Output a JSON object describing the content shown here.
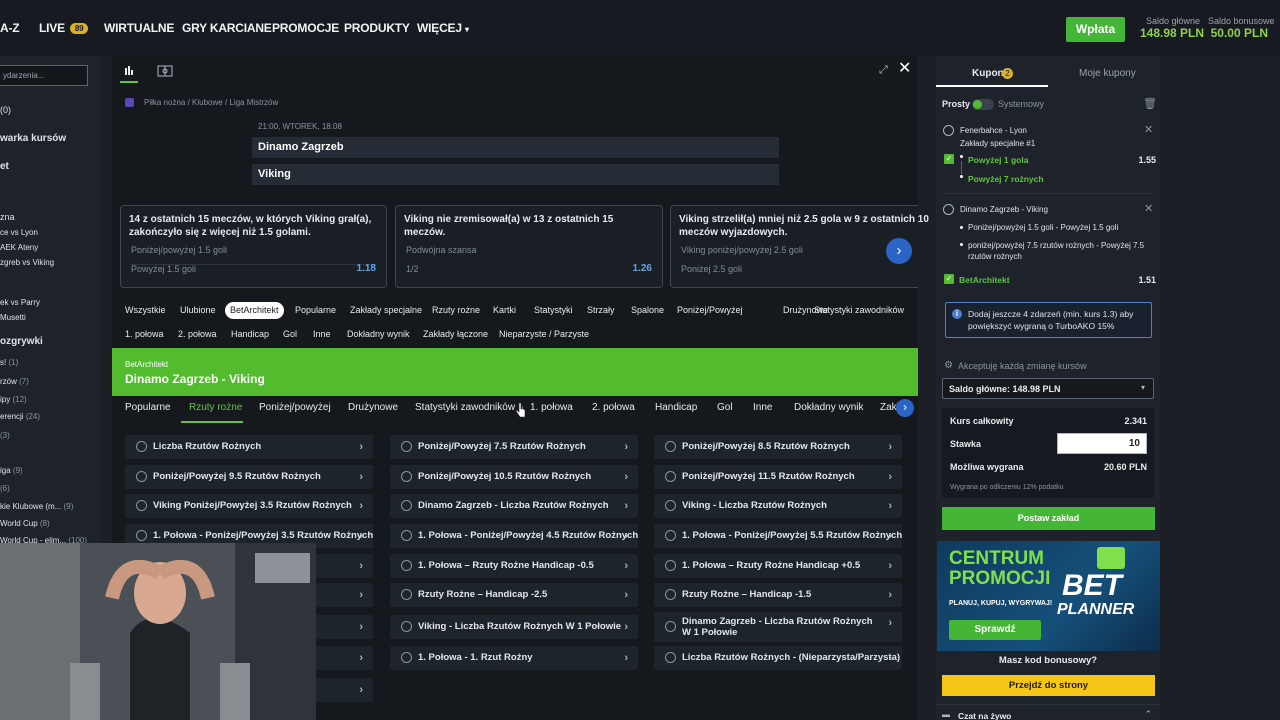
{
  "topnav": {
    "az": "A-Z",
    "live": "LIVE",
    "live_badge": "89",
    "items": [
      "WIRTUALNE",
      "GRY KARCIANE",
      "PROMOCJE",
      "PRODUKTY"
    ],
    "more": "WIĘCEJ"
  },
  "deposit_label": "Wpłata",
  "balance": {
    "main_label": "Saldo główne",
    "main_value": "148.98 PLN",
    "bonus_label": "Saldo bonusowe",
    "bonus_value": "50.00 PLN"
  },
  "sidebar": {
    "search_placeholder": "ydarzenia...",
    "items": [
      {
        "label": "(0)"
      },
      {
        "label": "warka kursów"
      },
      {
        "label": "et"
      },
      {
        "label": "zna"
      },
      {
        "label": "ce vs Lyon"
      },
      {
        "label": "AEK Ateny"
      },
      {
        "label": "zgreb vs Viking"
      },
      {
        "label": "ek vs Parry"
      },
      {
        "label": "Musetti"
      },
      {
        "label": "ozgrywki"
      },
      {
        "label": "s!",
        "count": "(1)"
      },
      {
        "label": "rzów",
        "count": "(7)"
      },
      {
        "label": "ipy",
        "count": "(12)"
      },
      {
        "label": "erencji",
        "count": "(24)"
      },
      {
        "label": "",
        "count": "(3)"
      },
      {
        "label": "iga",
        "count": "(9)"
      },
      {
        "label": "",
        "count": "(6)"
      },
      {
        "label": "kie Klubowe (m...",
        "count": "(9)"
      },
      {
        "label": "World Cup",
        "count": "(8)"
      },
      {
        "label": "World Cup - elim...",
        "count": "(100)"
      }
    ]
  },
  "event": {
    "breadcrumb": "Piłka nożna / Klubowe / Liga Mistrzów",
    "datetime": "21:00, WTOREK, 18.08",
    "home": "Dinamo Zagrzeb",
    "away": "Viking"
  },
  "stats_cards": [
    {
      "text": "14 z ostatnich 15 meczów, w których Viking grał(a), zakończyło się z więcej niż 1.5 golami.",
      "market": "Poniżej/powyżej 1.5 goli",
      "selection": "Powyżej 1.5 goli",
      "odd": "1.18"
    },
    {
      "text": "Viking nie zremisował(a) w 13 z ostatnich 15 meczów.",
      "market": "Podwójna szansa",
      "selection": "1/2",
      "odd": "1.26"
    },
    {
      "text": "Viking strzelił(a) mniej niż 2.5 gola w 9 z ostatnich 10 meczów wyjazdowych.",
      "market": "Viking poniżej/powyżej 2.5 goli",
      "selection": "Poniżej 2.5 goli",
      "odd": ""
    }
  ],
  "filter_row1": [
    "Wszystkie",
    "Ulubione",
    "BetArchitekt",
    "Popularne",
    "Zakłady specjalne",
    "Rzuty rożne",
    "Kartki",
    "Statystyki",
    "Strzały",
    "Spalone",
    "Poniżej/Powyżej",
    "Drużynowe",
    "Statystyki zawodników"
  ],
  "filter_row2": [
    "1. połowa",
    "2. połowa",
    "Handicap",
    "Gol",
    "Inne",
    "Dokładny wynik",
    "Zakłady łączone",
    "Nieparzyste / Parzyste"
  ],
  "betarchitekt": {
    "label": "BetArchitekt",
    "match": "Dinamo Zagrzeb - Viking"
  },
  "market_tabs": [
    "Popularne",
    "Rzuty rożne",
    "Poniżej/powyżej",
    "Drużynowe",
    "Statystyki zawodników",
    "1. połowa",
    "2. połowa",
    "Handicap",
    "Gol",
    "Inne",
    "Dokładny wynik",
    "Zakł"
  ],
  "markets": [
    [
      "Liczba Rzutów Rożnych",
      "Poniżej/Powyżej 7.5 Rzutów Rożnych",
      "Poniżej/Powyżej 8.5 Rzutów Rożnych"
    ],
    [
      "Poniżej/Powyżej 9.5 Rzutów Rożnych",
      "Poniżej/Powyżej 10.5 Rzutów Rożnych",
      "Poniżej/Powyżej 11.5 Rzutów Rożnych"
    ],
    [
      "Viking Poniżej/Powyżej 3.5 Rzutów Rożnych",
      "Dinamo Zagrzeb - Liczba Rzutów Rożnych",
      "Viking - Liczba Rzutów Rożnych"
    ],
    [
      "1. Połowa - Poniżej/Powyżej 3.5 Rzutów Rożnych",
      "1. Połowa - Poniżej/Powyżej 4.5 Rzutów Rożnych",
      "1. Połowa - Poniżej/Powyżej 5.5 Rzutów Rożnych"
    ],
    [
      "",
      "1. Połowa – Rzuty Rożne Handicap -0.5",
      "1. Połowa – Rzuty Rożne Handicap +0.5"
    ],
    [
      "",
      "Rzuty Rożne – Handicap -2.5",
      "Rzuty Rożne – Handicap -1.5"
    ],
    [
      "",
      "Viking - Liczba Rzutów Rożnych W 1 Połowie",
      "Dinamo Zagrzeb - Liczba Rzutów Rożnych W 1 Połowie"
    ],
    [
      "",
      "1. Połowa - 1. Rzut Rożny",
      "Liczba Rzutów Rożnych - (Nieparzysta/Parzysta)"
    ]
  ],
  "coupon": {
    "tab_coupon": "Kupon",
    "coupon_count": "2",
    "tab_my": "Moje kupony",
    "mode_simple": "Prosty",
    "mode_system": "Systemowy",
    "bet1": {
      "event": "Fenerbahce - Lyon",
      "market": "Zakłady specjalne #1",
      "sel1": "Powyżej 1 gola",
      "sel2": "Powyżej 7 rożnych",
      "odd": "1.55"
    },
    "bet2": {
      "event": "Dinamo Zagrzeb - Viking",
      "sel1": "Poniżej/powyżej 1.5 goli - Powyżej 1.5 goli",
      "sel2": "poniżej/powyżej 7.5 rzutów rożnych - Powyżej 7.5 rzutów rożnych",
      "builder": "BetArchitekt",
      "odd": "1.51"
    },
    "info": "Dodaj jeszcze 4 zdarzeń (min. kurs 1.3) aby powiększyć wygraną o TurboAKO 15%",
    "accept": "Akceptuję każdą zmianę kursów",
    "balance_select": "Saldo główne: 148.98 PLN",
    "total_odds_label": "Kurs całkowity",
    "total_odds": "2.341",
    "stake_label": "Stawka",
    "stake": "10",
    "win_label": "Możliwa wygrana",
    "win": "20.60 PLN",
    "tax_note": "Wygrana po odliczeniu 12% podatku",
    "place_bet": "Postaw zakład",
    "promo_title1": "CENTRUM",
    "promo_title2": "PROMOCJI",
    "promo_sub": "PLANUJ, KUPUJ, WYGRYWAJ!",
    "promo_btn": "Sprawdź",
    "promo_logo1": "BET",
    "promo_logo2": "PLANNER",
    "bonus_q": "Masz kod bonusowy?",
    "bonus_btn": "Przejdź do strony",
    "chat": "Czat na żywo"
  },
  "colors": {
    "green": "#53bb2e",
    "link_blue": "#5fa6e8",
    "yellow": "#f5c518"
  }
}
